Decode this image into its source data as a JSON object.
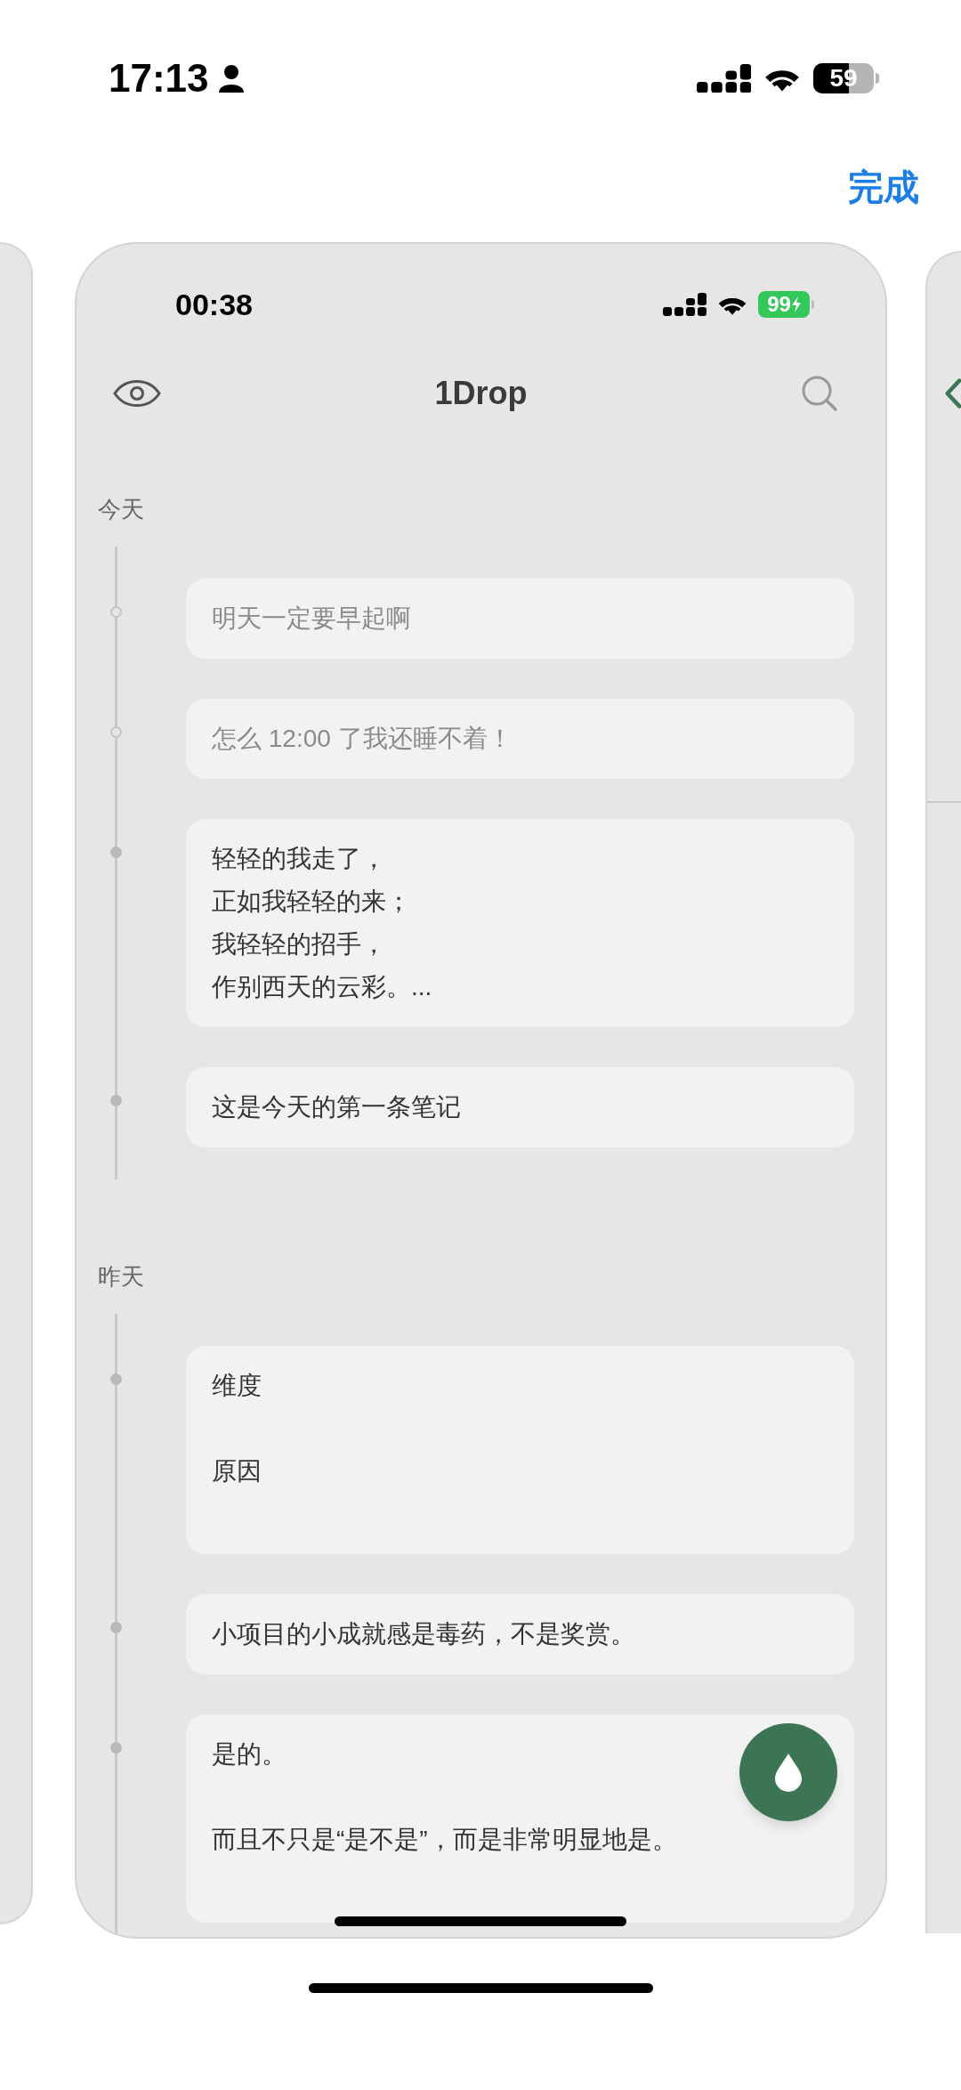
{
  "status_bar": {
    "time": "17:13",
    "battery": "59"
  },
  "done_button": "完成",
  "note_screen": {
    "status_bar": {
      "time": "00:38",
      "battery": "99"
    },
    "title": "1Drop",
    "sections": [
      {
        "label": "今天",
        "notes": [
          {
            "paragraphs": [
              [
                "明天一定要早起啊"
              ]
            ],
            "dimmed": true
          },
          {
            "paragraphs": [
              [
                "怎么 12:00 了我还睡不着！"
              ]
            ],
            "dimmed": true
          },
          {
            "paragraphs": [
              [
                "轻轻的我走了，",
                "正如我轻轻的来；",
                "我轻轻的招手，",
                "作别西天的云彩。..."
              ]
            ],
            "dimmed": false
          },
          {
            "paragraphs": [
              [
                "这是今天的第一条笔记"
              ]
            ],
            "dimmed": false
          }
        ]
      },
      {
        "label": "昨天",
        "notes": [
          {
            "paragraphs": [
              [
                "维度"
              ],
              [
                "原因"
              ]
            ],
            "dimmed": false
          },
          {
            "paragraphs": [
              [
                "小项目的小成就感是毒药，不是奖赏。"
              ]
            ],
            "dimmed": false
          },
          {
            "paragraphs": [
              [
                "是的。"
              ],
              [
                "而且不只是“是不是”，而是非常明显地是。"
              ]
            ],
            "dimmed": false
          }
        ]
      }
    ]
  }
}
